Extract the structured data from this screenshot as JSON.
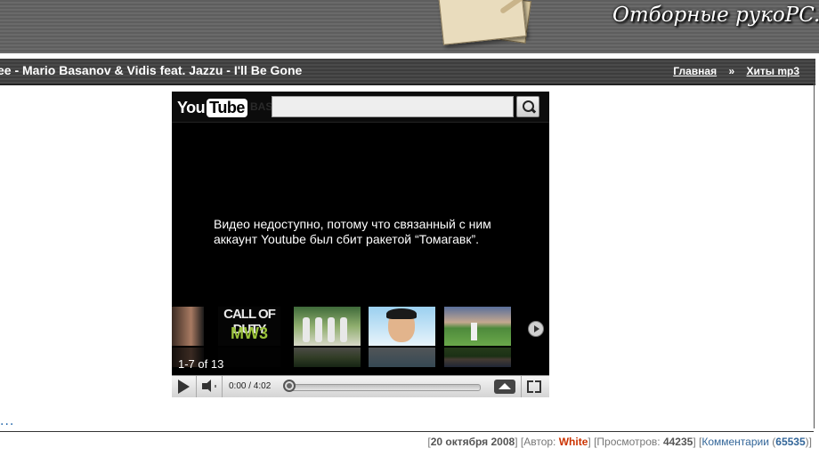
{
  "header": {
    "logo_text": "Отборные рукоPC..."
  },
  "post": {
    "title": "ee - Mario Basanov & Vidis feat. Jazzu - I'll Be Gone"
  },
  "breadcrumb": {
    "home": "Главная",
    "separator": "»",
    "section": "Хиты mp3"
  },
  "player": {
    "logo_you": "You",
    "logo_tube": "Tube",
    "logo_ghost": "BAS",
    "unavailable_message": "Видео недоступно, потому что связанный с ним аккаунт Youtube был сбит ракетой “Томагавк”.",
    "thumb_cod_title": "CALL OF DUTY",
    "thumb_cod_sub": "MW3",
    "related_count": "1-7 of 13",
    "time": "0:00 / 4:02",
    "progress": 0.0
  },
  "more_link": "...",
  "meta": {
    "date": "20 октября 2008",
    "author_label": "Автор:",
    "author": "White",
    "views_label": "Просмотров:",
    "views": "44235",
    "comments_label": "Комментарии",
    "comments": "65535"
  }
}
